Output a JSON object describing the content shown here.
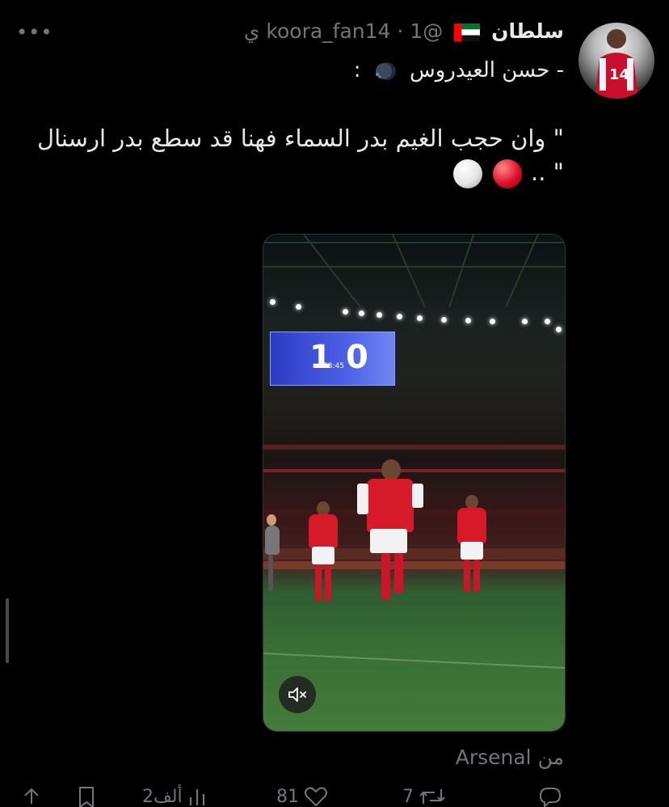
{
  "header": {
    "display_name": "سلطان",
    "handle": "@koora_fan14",
    "separator": "·",
    "time": "1 ي",
    "more_label": "•••"
  },
  "subtitle": {
    "text": "- حسن العيدروس",
    "trailing": ":"
  },
  "tweet": {
    "text_main": "\" وان حجب الغيم بدر السماء فهنا قد سطع بدر ارسنال",
    "text_end": "\" .."
  },
  "media": {
    "scoreboard_home": "1",
    "scoreboard_away": "0",
    "clock": "53:45"
  },
  "source": {
    "text": "من Arsenal"
  },
  "actions": {
    "reply_count": "",
    "retweet_count": "7",
    "like_count": "81",
    "views_count": "2ألف"
  },
  "colors": {
    "background": "#000000",
    "text_primary": "#e7e9ea",
    "text_secondary": "#71767b",
    "arsenal_red": "#d61a2a"
  }
}
